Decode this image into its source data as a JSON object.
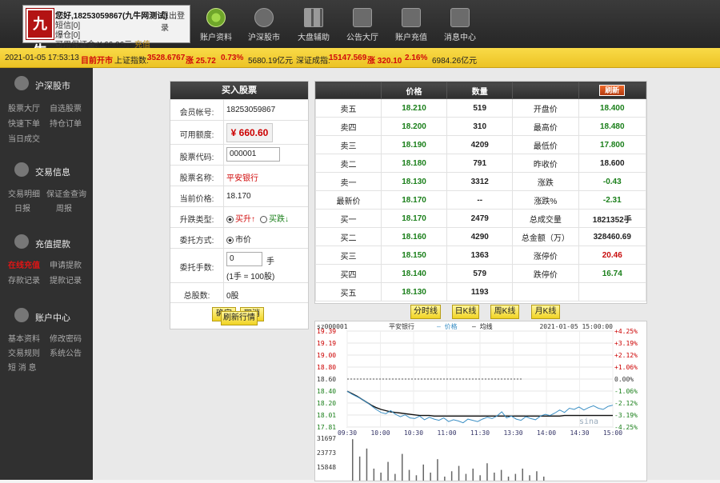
{
  "header": {
    "logo_text": "九牛",
    "greeting": "您好,18253059867(九牛网测试)",
    "logout": "退出登录",
    "sms": "短信[0]",
    "fav": "爆仓[0]",
    "margin_label": "可用保证金:",
    "margin_value": "¥ 66.06元",
    "recharge": "充值",
    "nav": [
      {
        "label": "账户资料",
        "icon": "gear-icon"
      },
      {
        "label": "沪深股市",
        "icon": "speedometer-icon"
      },
      {
        "label": "大盘辅助",
        "icon": "grid-icon"
      },
      {
        "label": "公告大厅",
        "icon": "inbox-icon"
      },
      {
        "label": "账户充值",
        "icon": "equalizer-icon"
      },
      {
        "label": "消息中心",
        "icon": "phone-icon"
      }
    ]
  },
  "ticker": {
    "datetime": "2021-01-05 17:53:13",
    "status": "目前开市",
    "sh_label": "上证指数:",
    "sh_value": "3528.6767",
    "sh_up": "涨 25.72",
    "sh_pct": "0.73%",
    "sh_amount": "5680.19亿元",
    "sz_label": "深证成指:",
    "sz_value": "15147.569",
    "sz_up": "涨 320.10",
    "sz_pct": "2.16%",
    "sz_amount": "6984.26亿元"
  },
  "sidebar": {
    "sections": [
      {
        "title": "沪深股市",
        "icon": "trend-icon",
        "items": [
          "股票大厅",
          "自选股票",
          "快速下单",
          "持仓订单",
          "当日成交"
        ]
      },
      {
        "title": "交易信息",
        "icon": "db-icon",
        "items": [
          "交易明细",
          "保证金查询",
          "日报",
          "周报"
        ]
      },
      {
        "title": "充值提款",
        "icon": "cash-icon",
        "items": [
          "在线充值",
          "申请提款",
          "存款记录",
          "提款记录"
        ]
      },
      {
        "title": "账户中心",
        "icon": "gear-icon",
        "items": [
          "基本资料",
          "修改密码",
          "交易规则",
          "系统公告",
          "短 消 息"
        ]
      }
    ]
  },
  "buy": {
    "title": "买入股票",
    "member_label": "会员帐号:",
    "member_value": "18253059867",
    "available_label": "可用额度:",
    "available_value": "¥ 660.60",
    "code_label": "股票代码:",
    "code_value": "000001",
    "name_label": "股票名称:",
    "name_value": "平安银行",
    "price_label": "当前价格:",
    "price_value": "18.170",
    "type_label": "升跌类型:",
    "type_opt1": "买升↑",
    "type_opt2": "买跌↓",
    "method_label": "委托方式:",
    "method_opt": "市价",
    "qty_label": "委托手数:",
    "qty_value": "0",
    "qty_unit": "手",
    "qty_note": "(1手 = 100股)",
    "total_label": "总股数:",
    "total_value": "0股",
    "confirm": "确定",
    "cancel": "取消",
    "refresh": "刷新行情"
  },
  "quote": {
    "header_price": "价格",
    "header_qty": "数量",
    "refresh_tag": "刷新",
    "rows": [
      {
        "label": "卖五",
        "price": "18.210",
        "qty": "519",
        "k": "开盘价",
        "v": "18.400",
        "vc": "gp"
      },
      {
        "label": "卖四",
        "price": "18.200",
        "qty": "310",
        "k": "最高价",
        "v": "18.480",
        "vc": "gp"
      },
      {
        "label": "卖三",
        "price": "18.190",
        "qty": "4209",
        "k": "最低价",
        "v": "17.800",
        "vc": "gp"
      },
      {
        "label": "卖二",
        "price": "18.180",
        "qty": "791",
        "k": "昨收价",
        "v": "18.600",
        "vc": "bp"
      },
      {
        "label": "卖一",
        "price": "18.130",
        "qty": "3312",
        "k": "涨跌",
        "v": "-0.43",
        "vc": "gp"
      },
      {
        "label": "最新价",
        "price": "18.170",
        "qty": "--",
        "k": "涨跌%",
        "v": "-2.31",
        "vc": "gp"
      },
      {
        "label": "买一",
        "price": "18.170",
        "qty": "2479",
        "k": "总成交量",
        "v": "1821352手",
        "vc": "bp"
      },
      {
        "label": "买二",
        "price": "18.160",
        "qty": "4290",
        "k": "总金额（万）",
        "v": "328460.69",
        "vc": "bp"
      },
      {
        "label": "买三",
        "price": "18.150",
        "qty": "1363",
        "k": "涨停价",
        "v": "20.46",
        "vc": "rp"
      },
      {
        "label": "买四",
        "price": "18.140",
        "qty": "579",
        "k": "跌停价",
        "v": "16.74",
        "vc": "gp"
      },
      {
        "label": "买五",
        "price": "18.130",
        "qty": "1193",
        "k": "",
        "v": "",
        "vc": "bp"
      }
    ]
  },
  "chart_tabs": [
    "分时线",
    "日K线",
    "周K线",
    "月K线"
  ],
  "chart_data": {
    "type": "line",
    "code": "sz000001",
    "name": "平安银行",
    "legend_price": "价格",
    "legend_avg": "均线",
    "datetime": "2021-01-05 15:00:00",
    "watermark": "sina",
    "ylim": [
      17.81,
      19.39
    ],
    "y_ticks": [
      "19.39",
      "19.19",
      "19.00",
      "18.80",
      "18.60",
      "18.40",
      "18.20",
      "18.01",
      "17.81"
    ],
    "pct_ticks": [
      "+4.25%",
      "+3.19%",
      "+2.12%",
      "+1.06%",
      "0.00%",
      "-1.06%",
      "-2.12%",
      "-3.19%",
      "-4.25%"
    ],
    "x_ticks": [
      "09:30",
      "10:00",
      "10:30",
      "11:00",
      "11:30",
      "13:30",
      "14:00",
      "14:30",
      "15:00"
    ],
    "prev_close": 18.6,
    "price_series": [
      18.4,
      18.35,
      18.31,
      18.27,
      18.22,
      18.16,
      18.1,
      18.05,
      18.03,
      18.08,
      18.02,
      17.98,
      18.01,
      17.96,
      17.95,
      17.99,
      17.93,
      17.97,
      17.94,
      17.92,
      17.96,
      17.9,
      17.93,
      17.91,
      17.88,
      17.94,
      17.92,
      17.9,
      17.94,
      17.97,
      17.95,
      17.99,
      18.06,
      17.96,
      17.99,
      17.94,
      17.92,
      17.98,
      17.95,
      17.93,
      17.99,
      18.02,
      18.0,
      18.04,
      18.09,
      18.05,
      18.12,
      18.1,
      18.14,
      18.09,
      18.13,
      18.16,
      18.12,
      18.1,
      18.15,
      18.17
    ],
    "avg_series": [
      18.4,
      18.36,
      18.32,
      18.27,
      18.22,
      18.17,
      18.13,
      18.1,
      18.08,
      18.06,
      18.05,
      18.04,
      18.03,
      18.02,
      18.01,
      18.0,
      18.0,
      18.0,
      17.99,
      17.99,
      17.99,
      17.99,
      17.99,
      17.99,
      17.99,
      17.99,
      17.99,
      17.99,
      17.99,
      17.99,
      17.99,
      17.99,
      17.99,
      17.99,
      17.99,
      17.99,
      17.99,
      17.99,
      17.99,
      17.99,
      17.99,
      17.99,
      17.99,
      17.99,
      17.99,
      18.0,
      18.0,
      18.0,
      18.0,
      18.0,
      18.0,
      18.0,
      18.0,
      18.0,
      18.0,
      18.0
    ],
    "vol_ticks": [
      "31697",
      "23773",
      "15848"
    ],
    "vol_max": 31697,
    "volumes": [
      31000,
      18000,
      24000,
      9000,
      6000,
      14000,
      5000,
      20000,
      8000,
      4000,
      12000,
      6000,
      16000,
      3000,
      7000,
      11000,
      5000,
      9000,
      4000,
      13000,
      6000,
      8000,
      3000,
      5000,
      9000,
      4000,
      7000,
      3000
    ]
  }
}
